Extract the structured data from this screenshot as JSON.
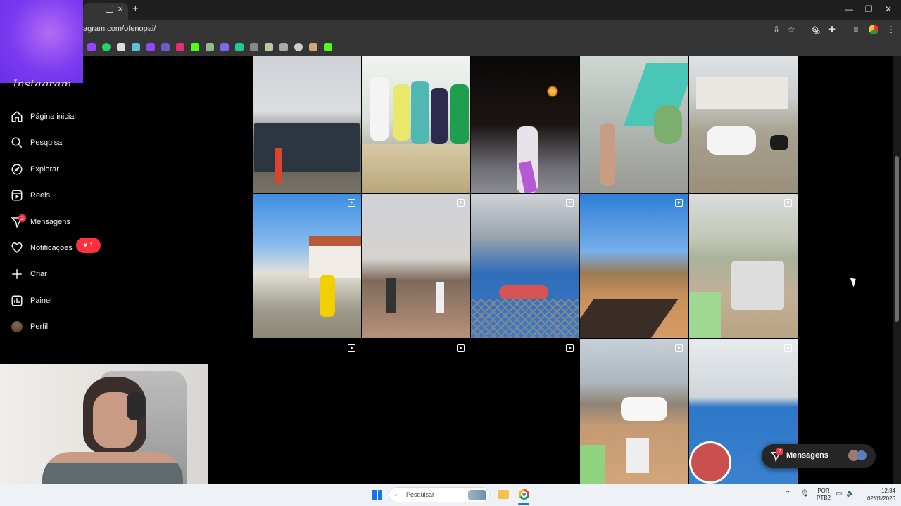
{
  "browser": {
    "url": "agram.com/ofenopai/",
    "tab_close": "×",
    "new_tab": "+",
    "window_controls": [
      "—",
      "❐",
      "✕"
    ],
    "extension_badge": "10"
  },
  "sidebar": {
    "items": [
      {
        "label": "Página inicial",
        "icon": "home-icon"
      },
      {
        "label": "Pesquisa",
        "icon": "search-icon"
      },
      {
        "label": "Explorar",
        "icon": "compass-icon"
      },
      {
        "label": "Reels",
        "icon": "reels-icon"
      },
      {
        "label": "Mensagens",
        "icon": "messenger-icon",
        "badge": "2"
      },
      {
        "label": "Notificações",
        "icon": "heart-icon"
      },
      {
        "label": "Criar",
        "icon": "plus-icon"
      },
      {
        "label": "Painel",
        "icon": "dashboard-icon"
      },
      {
        "label": "Perfil",
        "icon": "avatar"
      }
    ],
    "notif_badge": "1",
    "logo": "Instagram"
  },
  "messages_pill": {
    "label": "Mensagens",
    "badge": "2"
  },
  "taskbar": {
    "search_placeholder": "Pesquisar",
    "lang_line1": "POR",
    "lang_line2": "PTB2",
    "time": "12:34",
    "date": "02/01/2026"
  },
  "colors": {
    "accent_red": "#ff3040",
    "overlay": "#7b3bf0"
  }
}
